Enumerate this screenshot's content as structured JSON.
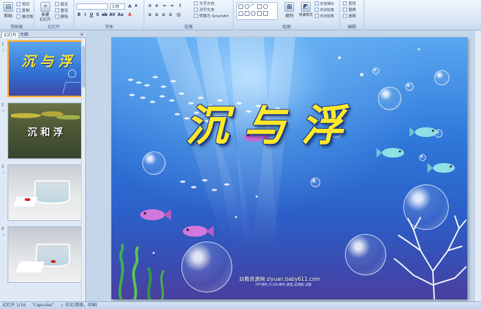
{
  "ribbon": {
    "groups": [
      {
        "label": "剪贴板"
      },
      {
        "label": "幻灯片"
      },
      {
        "label": "字体"
      },
      {
        "label": "段落"
      },
      {
        "label": "绘图"
      },
      {
        "label": "编辑"
      }
    ],
    "paste_label": "粘贴",
    "cut_label": "剪切",
    "copy_label": "复制",
    "format_painter_label": "格式刷",
    "new_slide_label": "新建\n幻灯片",
    "layout_label": "版式",
    "reset_label": "重设",
    "delete_label": "删除",
    "font_name": "",
    "font_size": "138",
    "text_direction_label": "文字方向",
    "align_text_label": "对齐文本",
    "smartart_label": "转换为 SmartArt",
    "arrange_label": "排列",
    "quick_styles_label": "快速样式",
    "shape_fill_label": "形状填充",
    "shape_outline_label": "形状轮廓",
    "shape_effects_label": "形状效果",
    "find_label": "查找",
    "replace_label": "替换",
    "select_label": "选择"
  },
  "panel": {
    "tabs": [
      {
        "label": "幻灯片"
      },
      {
        "label": "大纲"
      }
    ],
    "close_label": "×",
    "slides": [
      {
        "num": "1",
        "title": "沉 与 浮"
      },
      {
        "num": "2",
        "title": "沉 和 浮"
      },
      {
        "num": "3",
        "title": ""
      },
      {
        "num": "4",
        "title": ""
      }
    ]
  },
  "slide": {
    "title": "沉与浮",
    "watermark": "幼教资源网 ziyuan.baby611.com",
    "watermark_sub": "PPT课件_FLASH课件_教案_说课稿_试题"
  },
  "status": {
    "slide_info": "幻灯片 1/16",
    "theme": "\"Capsules\"",
    "language": "中文(简体，中国)"
  },
  "colors": {
    "title": "#ffe92a",
    "ribbon_bg": "#dbe7f5",
    "slide_top": "#5aa6f0",
    "slide_bottom": "#4b3f9e",
    "selection": "#f1a73b"
  }
}
